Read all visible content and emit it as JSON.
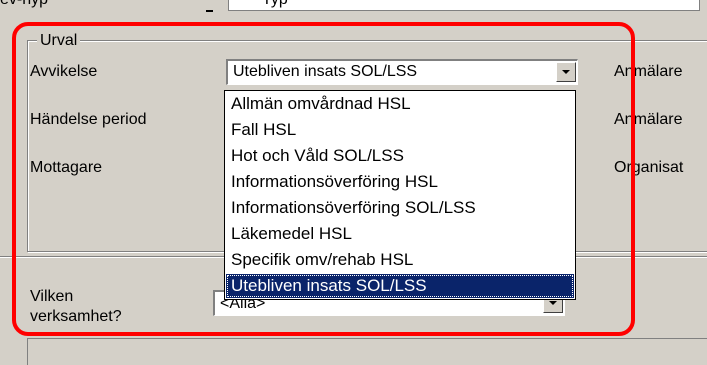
{
  "top": {
    "left_label": "ev-hyp",
    "right_value": "Typ"
  },
  "urval": {
    "legend": "Urval",
    "labels": {
      "avvikelse": "Avvikelse",
      "handelse_period": "Händelse period",
      "mottagare": "Mottagare",
      "vilken_verksamhet_line1": "Vilken",
      "vilken_verksamhet_line2": "verksamhet?"
    },
    "right_labels": {
      "anmalare_1": "Anmälare",
      "anmalare_2": "Anmälare",
      "organisat": "Organisat"
    },
    "avvikelse_combo": {
      "selected": "Utebliven insats SOL/LSS",
      "options": [
        "Allmän omvårdnad HSL",
        "Fall HSL",
        "Hot och Våld SOL/LSS",
        "Informationsöverföring HSL",
        "Informationsöverföring SOL/LSS",
        "Läkemedel HSL",
        "Specifik omv/rehab HSL",
        "Utebliven insats SOL/LSS"
      ],
      "highlighted_index": 7
    },
    "verksamhet_combo": {
      "selected": "<Alla>"
    }
  },
  "colors": {
    "window_bg": "#d4d0c8",
    "selection_bg": "#0a246a",
    "annotation_red": "#ff0000"
  },
  "icons": {
    "dropdown_arrow": "chevron-down-icon"
  }
}
